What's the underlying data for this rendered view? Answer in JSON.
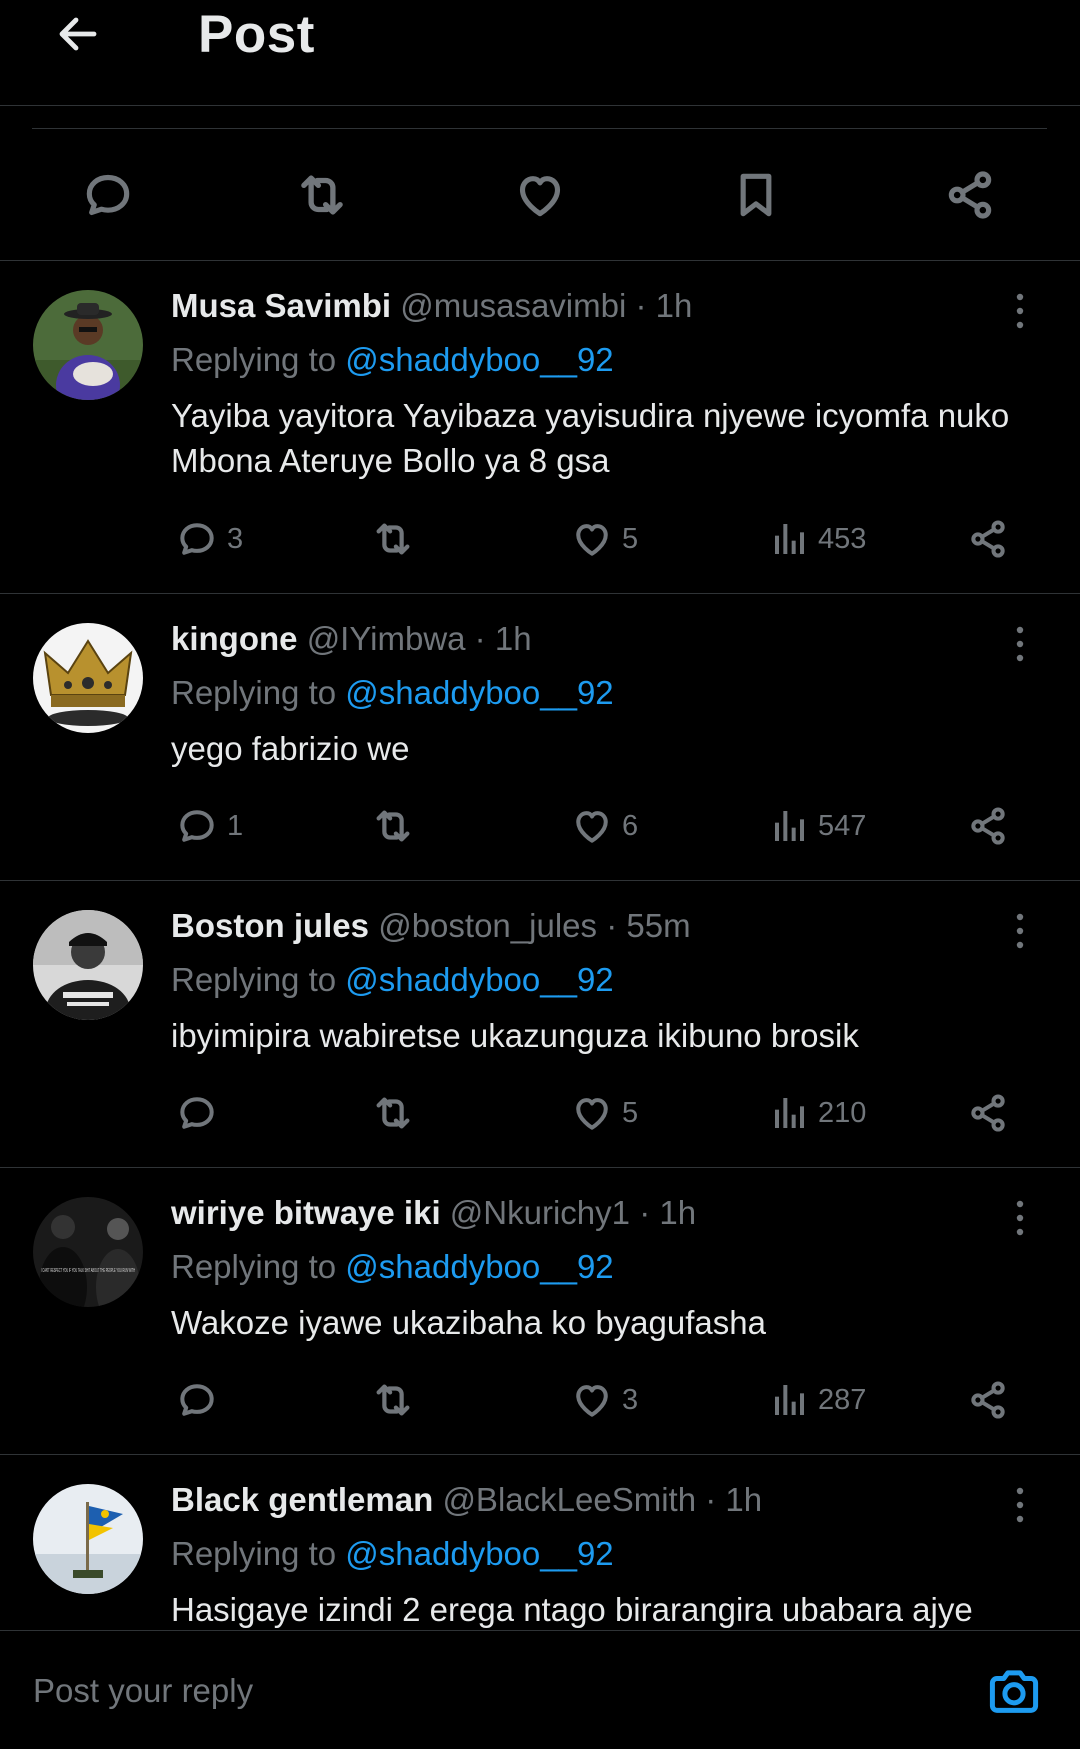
{
  "header": {
    "title": "Post"
  },
  "reply_bar": {
    "placeholder": "Post your reply"
  },
  "replies": [
    {
      "name": "Musa Savimbi",
      "handle": "@musasavimbi",
      "time": "1h",
      "replying_prefix": "Replying to",
      "replying_to": "@shaddyboo__92",
      "text": "Yayiba yayitora Yayibaza yayisudira njyewe icyomfa nuko Mbona Ateruye Bollo ya 8 gsa",
      "replies": "3",
      "retweets": "",
      "likes": "5",
      "views": "453"
    },
    {
      "name": "kingone",
      "handle": "@IYimbwa",
      "time": "1h",
      "replying_prefix": "Replying to",
      "replying_to": "@shaddyboo__92",
      "text": "yego fabrizio we",
      "replies": "1",
      "retweets": "",
      "likes": "6",
      "views": "547"
    },
    {
      "name": "Boston jules",
      "handle": "@boston_jules",
      "time": "55m",
      "replying_prefix": "Replying to",
      "replying_to": "@shaddyboo__92",
      "text": "ibyimipira wabiretse ukazunguza ikibuno brosik",
      "replies": "",
      "retweets": "",
      "likes": "5",
      "views": "210"
    },
    {
      "name": "wiriye bitwaye iki",
      "handle": "@Nkurichy1",
      "time": "1h",
      "replying_prefix": "Replying to",
      "replying_to": "@shaddyboo__92",
      "text": "Wakoze iyawe ukazibaha ko byagufasha",
      "replies": "",
      "retweets": "",
      "likes": "3",
      "views": "287",
      "avatar_text": "I CAN'T RESPECT YOU IF YOU TALK SHIT ABOUT THE PEOPLE YOU RUN WITH"
    },
    {
      "name": "Black gentleman",
      "handle": "@BlackLeeSmith",
      "time": "1h",
      "replying_prefix": "Replying to",
      "replying_to": "@shaddyboo__92",
      "text": "Hasigaye izindi 2 erega ntago birarangira ubabara ajye",
      "replies": "",
      "retweets": "",
      "likes": "",
      "views": ""
    }
  ],
  "colors": {
    "background": "#000000",
    "text": "#e7e9ea",
    "muted": "#71767b",
    "accent": "#1d9bf0",
    "divider": "#2f3336"
  },
  "icons": [
    "back-arrow-icon",
    "reply-icon",
    "retweet-icon",
    "like-icon",
    "bookmark-icon",
    "share-icon",
    "more-icon",
    "views-icon",
    "camera-icon"
  ]
}
